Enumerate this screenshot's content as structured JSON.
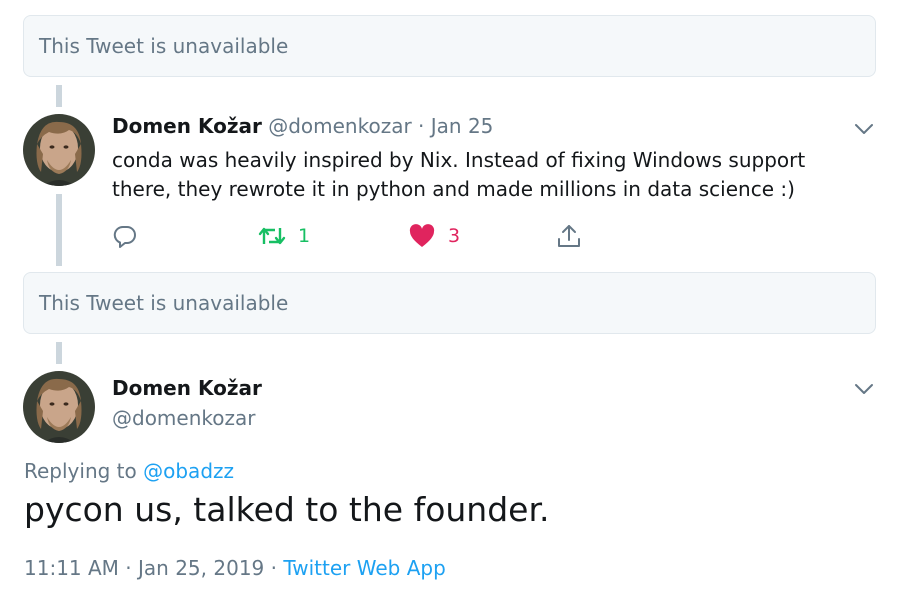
{
  "unavailable_1": {
    "text": "This Tweet is unavailable"
  },
  "tweet1": {
    "name": "Domen Kožar",
    "handle": "@domenkozar",
    "separator": "·",
    "date": "Jan 25",
    "text": "conda was heavily inspired by Nix. Instead of fixing Windows support there, they rewrote it in python and made millions in data science :)",
    "actions": {
      "reply_icon": "reply-icon",
      "retweet_icon": "retweet-icon",
      "retweet_count": "1",
      "like_icon": "heart-icon",
      "like_count": "3",
      "share_icon": "share-icon"
    },
    "colors": {
      "retweet": "#17bf63",
      "like": "#e0245e"
    }
  },
  "unavailable_2": {
    "text": "This Tweet is unavailable"
  },
  "tweet2": {
    "name": "Domen Kožar",
    "handle": "@domenkozar",
    "replying_prefix": "Replying to",
    "replying_to": "@obadzz",
    "text": "pycon us, talked to the founder.",
    "time": "11:11 AM",
    "meta_sep": "·",
    "date": "Jan 25, 2019",
    "meta_sep2": "·",
    "app": "Twitter Web App"
  },
  "colors": {
    "link": "#1da1f2",
    "secondary": "#657786",
    "primary": "#14171a",
    "thread_line": "#ccd6dd"
  }
}
